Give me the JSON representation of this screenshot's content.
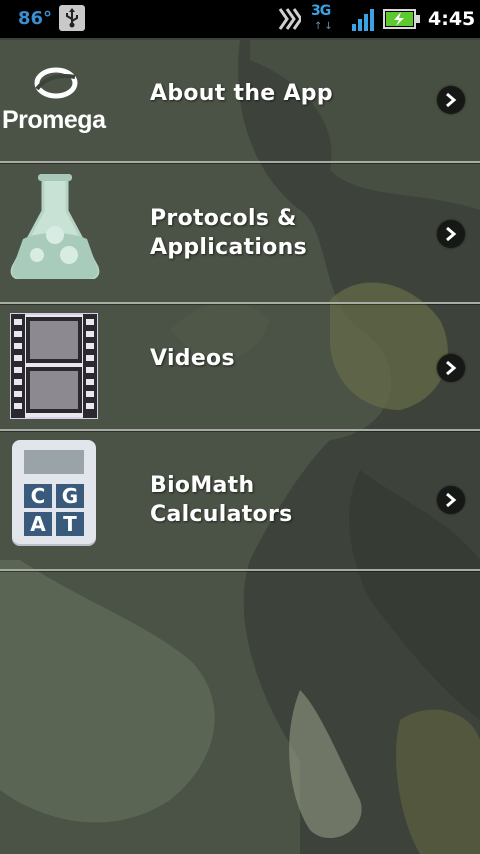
{
  "status_bar": {
    "temperature": "86°",
    "network": "3G",
    "network_arrows": "↑↓",
    "time": "4:45",
    "icons": [
      "usb-icon",
      "sync-icon",
      "signal-icon",
      "battery-charging-icon"
    ]
  },
  "menu": {
    "items": [
      {
        "label_lines": [
          "About the App"
        ],
        "icon": "promega-logo",
        "logo_text": "Promega"
      },
      {
        "label_lines": [
          "Protocols &",
          "Applications"
        ],
        "icon": "flask-icon"
      },
      {
        "label_lines": [
          "Videos"
        ],
        "icon": "film-strip-icon"
      },
      {
        "label_lines": [
          "BioMath",
          "Calculators"
        ],
        "icon": "calculator-icon",
        "calculator_keys": [
          "C",
          "G",
          "A",
          "T"
        ]
      }
    ]
  },
  "colors": {
    "status_bar_bg": "#000000",
    "accent_blue": "#3aa3e6",
    "battery_green": "#5ec82f",
    "divider": "#a8aca4",
    "label_text": "#ffffff"
  }
}
